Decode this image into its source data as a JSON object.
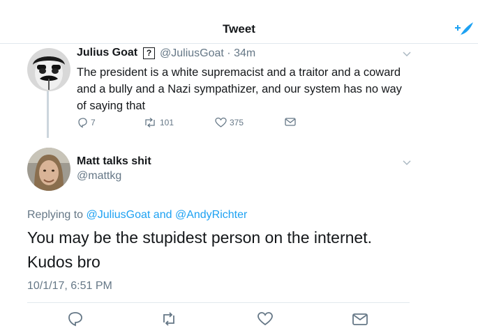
{
  "header": {
    "title": "Tweet"
  },
  "colors": {
    "accent": "#1da1f2",
    "muted": "#657786",
    "text": "#14171a",
    "border": "#e1e8ed"
  },
  "tweet1": {
    "name": "Julius Goat",
    "badge": "?",
    "handle": "@JuliusGoat",
    "time": "34m",
    "text": "The president is a white supremacist and a traitor and a coward and a bully and a Nazi sympathizer, and our system has no way of saying that",
    "replies": "7",
    "retweets": "101",
    "likes": "375"
  },
  "tweet2": {
    "name": "Matt talks shit",
    "handle": "@mattkg",
    "replying_prefix": "Replying to",
    "reply_user1": "@JuliusGoat",
    "reply_and": "and",
    "reply_user2": "@AndyRichter",
    "text_line1": "You may be the stupidest person on the internet.",
    "text_line2": "Kudos bro",
    "timestamp": "10/1/17, 6:51 PM"
  },
  "icons": {
    "compose": "compose-tweet-icon",
    "reply": "reply-icon",
    "retweet": "retweet-icon",
    "like": "heart-icon",
    "dm": "envelope-icon",
    "caret": "chevron-down-icon"
  }
}
